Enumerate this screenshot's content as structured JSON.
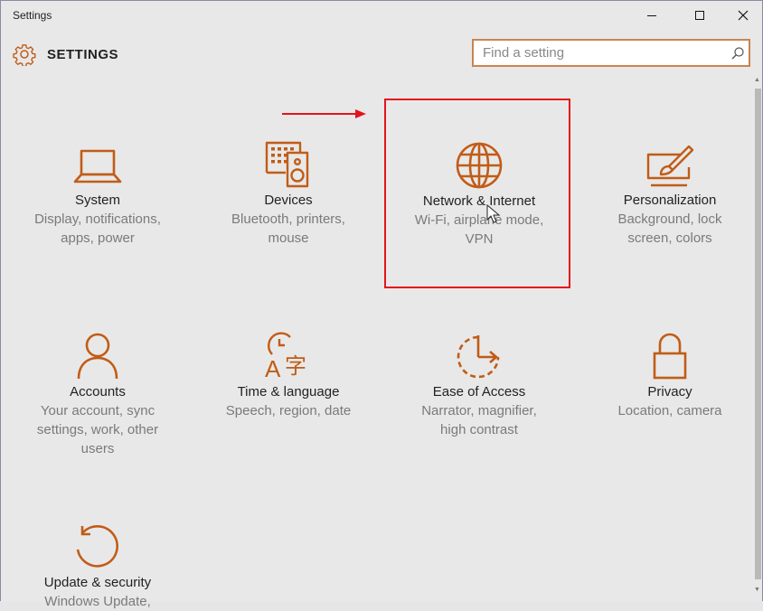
{
  "window": {
    "title": "Settings",
    "controls": [
      "minimize",
      "maximize",
      "close"
    ]
  },
  "header": {
    "app_title": "SETTINGS",
    "icon": "gear-icon"
  },
  "search": {
    "placeholder": "Find a setting",
    "value": "",
    "icon": "search-icon"
  },
  "tiles": [
    {
      "label": "System",
      "desc1": "Display, notifications,",
      "desc2": "apps, power",
      "desc3": "",
      "icon": "laptop-icon"
    },
    {
      "label": "Devices",
      "desc1": "Bluetooth, printers,",
      "desc2": "mouse",
      "desc3": "",
      "icon": "keyboard-speaker-icon"
    },
    {
      "label": "Network & Internet",
      "desc1": "Wi-Fi, airplane mode,",
      "desc2": "VPN",
      "desc3": "",
      "icon": "globe-icon"
    },
    {
      "label": "Personalization",
      "desc1": "Background, lock",
      "desc2": "screen, colors",
      "desc3": "",
      "icon": "paintbrush-screen-icon"
    },
    {
      "label": "Accounts",
      "desc1": "Your account, sync",
      "desc2": "settings, work, other",
      "desc3": "users",
      "icon": "person-icon"
    },
    {
      "label": "Time & language",
      "desc1": "Speech, region, date",
      "desc2": "",
      "desc3": "",
      "icon": "clock-language-icon"
    },
    {
      "label": "Ease of Access",
      "desc1": "Narrator, magnifier,",
      "desc2": "high contrast",
      "desc3": "",
      "icon": "ease-of-access-icon"
    },
    {
      "label": "Privacy",
      "desc1": "Location, camera",
      "desc2": "",
      "desc3": "",
      "icon": "lock-icon"
    },
    {
      "label": "Update & security",
      "desc1": "Windows Update,",
      "desc2": "",
      "desc3": "",
      "icon": "refresh-icon"
    }
  ],
  "colors": {
    "accent": "#c15c17",
    "highlight": "#e3141d",
    "background": "#e8e8e8"
  }
}
